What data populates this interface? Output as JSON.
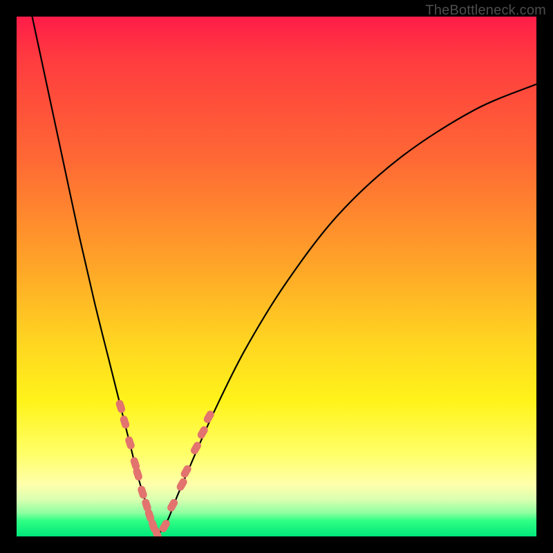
{
  "watermark": "TheBottleneck.com",
  "colors": {
    "frame": "#000000",
    "curve": "#000000",
    "marker": "#e2736e",
    "gradient_top": "#ff1c49",
    "gradient_bottom": "#00e77a"
  },
  "chart_data": {
    "type": "line",
    "title": "",
    "xlabel": "",
    "ylabel": "",
    "xlim": [
      0,
      100
    ],
    "ylim": [
      0,
      100
    ],
    "note": "No axis ticks or numeric labels are rendered. The chart shows a bottleneck curve: a steep descending left branch meeting a shallower ascending right branch near x≈27, y≈0, with pink data markers clustered around the minimum on both branches. Y-values represent bottleneck percentage (higher = worse), background gradient encodes the same (red=high, green=low).",
    "series": [
      {
        "name": "left-branch",
        "x": [
          3,
          6,
          9,
          12,
          15,
          18,
          20,
          22,
          23.5,
          25,
          26,
          27
        ],
        "y": [
          100,
          86,
          72,
          58,
          45,
          33,
          25,
          17,
          11,
          6,
          2.5,
          0
        ]
      },
      {
        "name": "right-branch",
        "x": [
          27,
          29,
          31,
          34,
          38,
          44,
          52,
          62,
          74,
          88,
          100
        ],
        "y": [
          0,
          3,
          8,
          15,
          24,
          36,
          49,
          62,
          73,
          82,
          87
        ]
      }
    ],
    "markers": [
      {
        "branch": "left",
        "x": 20.0,
        "y": 25.0
      },
      {
        "branch": "left",
        "x": 20.8,
        "y": 22.0
      },
      {
        "branch": "left",
        "x": 21.8,
        "y": 18.0
      },
      {
        "branch": "left",
        "x": 22.8,
        "y": 14.0
      },
      {
        "branch": "left",
        "x": 23.3,
        "y": 12.0
      },
      {
        "branch": "left",
        "x": 24.2,
        "y": 8.5
      },
      {
        "branch": "left",
        "x": 25.0,
        "y": 6.0
      },
      {
        "branch": "left",
        "x": 25.6,
        "y": 4.0
      },
      {
        "branch": "left",
        "x": 26.3,
        "y": 2.0
      },
      {
        "branch": "left",
        "x": 27.0,
        "y": 0.5
      },
      {
        "branch": "right",
        "x": 28.5,
        "y": 2.0
      },
      {
        "branch": "right",
        "x": 30.0,
        "y": 6.0
      },
      {
        "branch": "right",
        "x": 31.8,
        "y": 10.0
      },
      {
        "branch": "right",
        "x": 32.6,
        "y": 12.5
      },
      {
        "branch": "right",
        "x": 34.5,
        "y": 17.0
      },
      {
        "branch": "right",
        "x": 35.8,
        "y": 20.0
      },
      {
        "branch": "right",
        "x": 37.0,
        "y": 23.0
      }
    ]
  }
}
